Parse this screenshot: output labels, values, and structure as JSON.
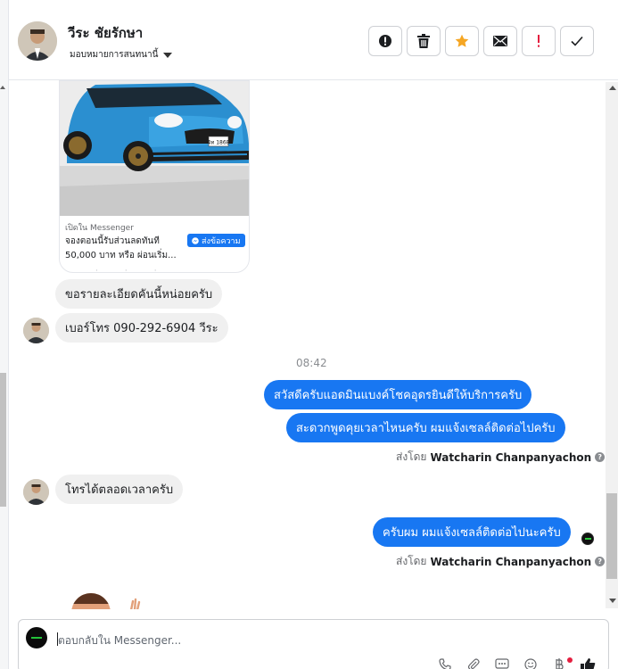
{
  "contact": {
    "name": "วีระ ชัยรักษา",
    "assign_label": "มอบหมายการสนทนานี้"
  },
  "header_actions": [
    {
      "name": "spam-button",
      "icon": "alert-circle-icon"
    },
    {
      "name": "delete-button",
      "icon": "trash-icon"
    },
    {
      "name": "star-button",
      "icon": "star-icon",
      "color": "#f5a623"
    },
    {
      "name": "mail-button",
      "icon": "envelope-icon"
    },
    {
      "name": "important-button",
      "icon": "exclamation-icon",
      "color": "#e41e3f"
    },
    {
      "name": "done-button",
      "icon": "check-icon"
    }
  ],
  "card": {
    "source": "เปิดใน Messenger",
    "line1": "จองตอนนี้รับส่วนลดทันที",
    "line2": "50,000 บาท หรือ  ผ่อนเริ่ม...",
    "button": "ส่งข้อความ",
    "plate": "4ท 1868"
  },
  "messages": {
    "in1": "ขอรายละเอียดคันนี้หน่อยครับ",
    "in2": "เบอร์โทร 090-292-6904 วีระ",
    "time": "08:42",
    "out1": "สวัสดีครับแอดมินแบงค์โชคอุดรยินดีให้บริการครับ",
    "out2": "สะดวกพูดคุยเวลาไหนครับ ผมแจ้งเซลล์ติดต่อไปครับ",
    "sent_prefix": "ส่งโดย",
    "sent_name": "Watcharin Chanpanyachon",
    "in3": "โทรได้ตลอดเวลาครับ",
    "out3": "ครับผม ผมแจ้งเซลล์ติดต่อไปนะครับ"
  },
  "reply": {
    "placeholder": "ตอบกลับใน Messenger..."
  },
  "colors": {
    "accent": "#1877f2",
    "incoming_bubble": "#f0f0f0",
    "star": "#f5a623",
    "alert": "#e41e3f"
  }
}
